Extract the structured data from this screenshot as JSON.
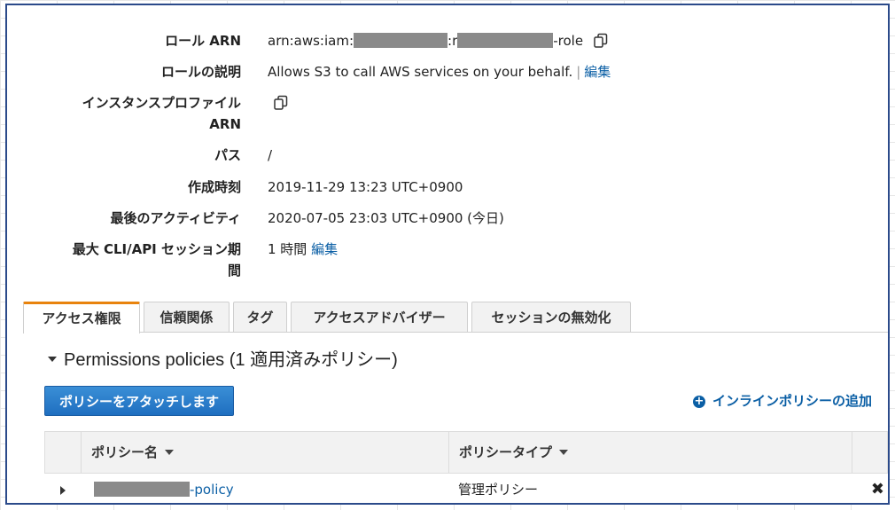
{
  "summary": {
    "role_arn_label": "ロール ARN",
    "role_arn_prefix": "arn:aws:iam:",
    "role_arn_mid": ":r",
    "role_arn_suffix": "-role",
    "role_desc_label": "ロールの説明",
    "role_desc_value": "Allows S3 to call AWS services on your behalf.",
    "role_desc_separator": "|",
    "role_desc_edit": "編集",
    "instance_profile_label_1": "インスタンスプロファイル",
    "instance_profile_label_2": "ARN",
    "path_label": "パス",
    "path_value": "/",
    "created_label": "作成時刻",
    "created_value": "2019-11-29 13:23 UTC+0900",
    "last_activity_label": "最後のアクティビティ",
    "last_activity_value": "2020-07-05 23:03 UTC+0900 (今日)",
    "max_session_label_1": "最大 CLI/API セッション期",
    "max_session_label_2": "間",
    "max_session_value": "1 時間",
    "max_session_edit": "編集"
  },
  "tabs": [
    {
      "label": "アクセス権限",
      "active": true
    },
    {
      "label": "信頼関係",
      "active": false
    },
    {
      "label": "タグ",
      "active": false
    },
    {
      "label": "アクセスアドバイザー",
      "active": false
    },
    {
      "label": "セッションの無効化",
      "active": false
    }
  ],
  "permissions": {
    "title": "Permissions policies (1 適用済みポリシー)",
    "attach_button": "ポリシーをアタッチします",
    "inline_add": "インラインポリシーの追加",
    "columns": [
      "ポリシー名",
      "ポリシータイプ"
    ],
    "rows": [
      {
        "name_suffix": "-policy",
        "type": "管理ポリシー",
        "remove": "✖"
      }
    ]
  },
  "colors": {
    "accent_tab": "#e8830d",
    "link": "#0b5fa5",
    "button": "#1f6fc0",
    "frame": "#2b4a8a"
  }
}
